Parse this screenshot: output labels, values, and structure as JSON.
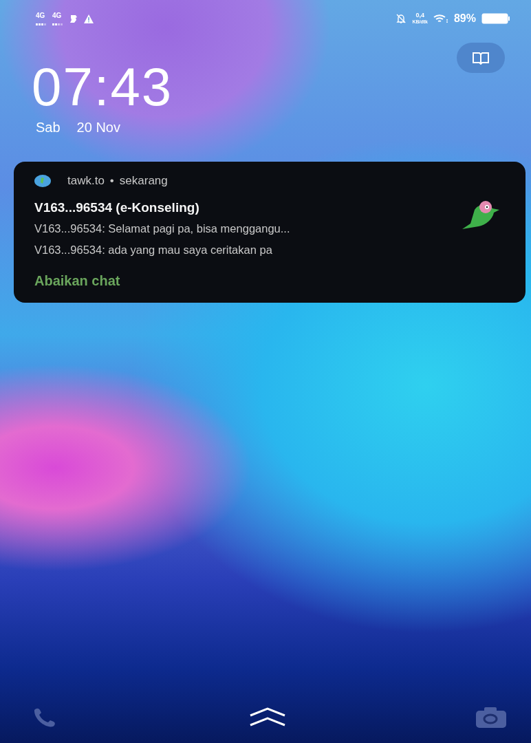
{
  "status_bar": {
    "networks": [
      {
        "label": "4G"
      },
      {
        "label": "4G"
      }
    ],
    "data_speed": {
      "value": "0,4",
      "unit": "KB/dtk"
    },
    "battery": "89%"
  },
  "clock": {
    "time": "07:43",
    "day": "Sab",
    "date": "20 Nov"
  },
  "notification": {
    "app": "tawk.to",
    "separator": "•",
    "time": "sekarang",
    "title": "V163...96534 (e-Konseling)",
    "lines": [
      "V163...96534: Selamat pagi pa, bisa menggangu...",
      "V163...96534: ada yang mau saya ceritakan pa"
    ],
    "action": "Abaikan chat"
  }
}
